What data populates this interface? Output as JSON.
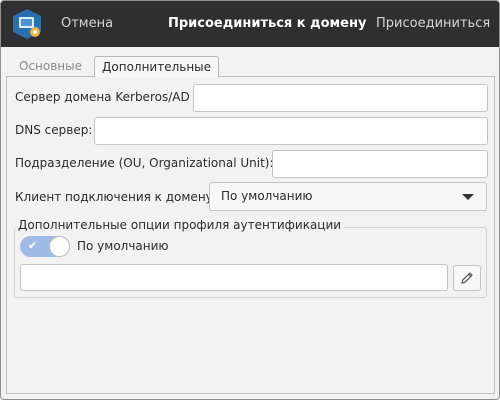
{
  "header": {
    "cancel_label": "Отмена",
    "title": "Присоединиться к домену",
    "join_label": "Присоединиться",
    "app_icon": "domain-app-icon"
  },
  "tabs": [
    {
      "label": "Основные",
      "active": false
    },
    {
      "label": "Дополнительные",
      "active": true
    }
  ],
  "form": {
    "kerberos_label": "Сервер домена Kerberos/AD",
    "kerberos_value": "",
    "dns_label": "DNS сервер:",
    "dns_value": "",
    "ou_label": "Подразделение (OU, Organizational Unit):",
    "ou_value": "",
    "client_label": "Клиент подключения к домену",
    "client_value": "По умолчанию"
  },
  "auth_group": {
    "title": "Дополнительные опции профиля аутентификации",
    "toggle_label": "По умолчанию",
    "toggle_on": true,
    "options_value": "",
    "edit_icon": "pencil-icon"
  },
  "colors": {
    "header_bg": "#2f2f2f",
    "toggle_on": "#9fbbe7"
  }
}
